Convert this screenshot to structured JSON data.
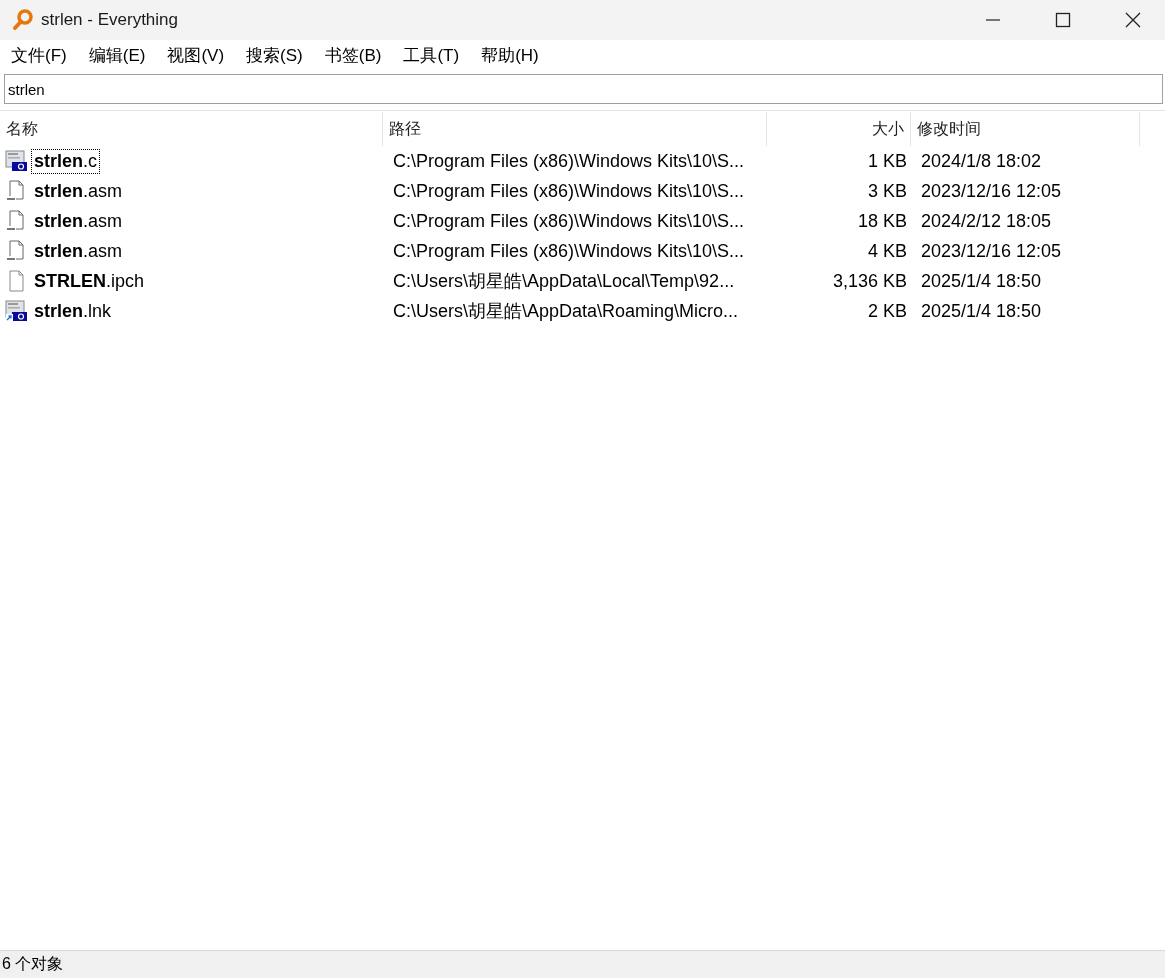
{
  "window": {
    "title": "strlen - Everything"
  },
  "menu": [
    "文件(F)",
    "编辑(E)",
    "视图(V)",
    "搜索(S)",
    "书签(B)",
    "工具(T)",
    "帮助(H)"
  ],
  "search": {
    "value": "strlen"
  },
  "table": {
    "columns": [
      "名称",
      "路径",
      "大小",
      "修改时间"
    ],
    "rows": [
      {
        "kind": "c",
        "name": "**strlen**.c",
        "path": "C:\\Program Files (x86)\\Windows Kits\\10\\S...",
        "size": "1 KB",
        "modified": "2024/1/8 18:02",
        "focused": true
      },
      {
        "kind": "asm",
        "name": "**strlen**.asm",
        "path": "C:\\Program Files (x86)\\Windows Kits\\10\\S...",
        "size": "3 KB",
        "modified": "2023/12/16 12:05",
        "focused": false
      },
      {
        "kind": "asm",
        "name": "**strlen**.asm",
        "path": "C:\\Program Files (x86)\\Windows Kits\\10\\S...",
        "size": "18 KB",
        "modified": "2024/2/12 18:05",
        "focused": false
      },
      {
        "kind": "asm",
        "name": "**strlen**.asm",
        "path": "C:\\Program Files (x86)\\Windows Kits\\10\\S...",
        "size": "4 KB",
        "modified": "2023/12/16 12:05",
        "focused": false
      },
      {
        "kind": "blank",
        "name": "**STRLEN**.ipch",
        "path": "C:\\Users\\胡星皓\\AppData\\Local\\Temp\\92...",
        "size": "3,136 KB",
        "modified": "2025/1/4 18:50",
        "focused": false
      },
      {
        "kind": "lnk",
        "name": "**strlen**.lnk",
        "path": "C:\\Users\\胡星皓\\AppData\\Roaming\\Micro...",
        "size": "2 KB",
        "modified": "2025/1/4 18:50",
        "focused": false
      }
    ]
  },
  "status_bar": "6 个对象"
}
